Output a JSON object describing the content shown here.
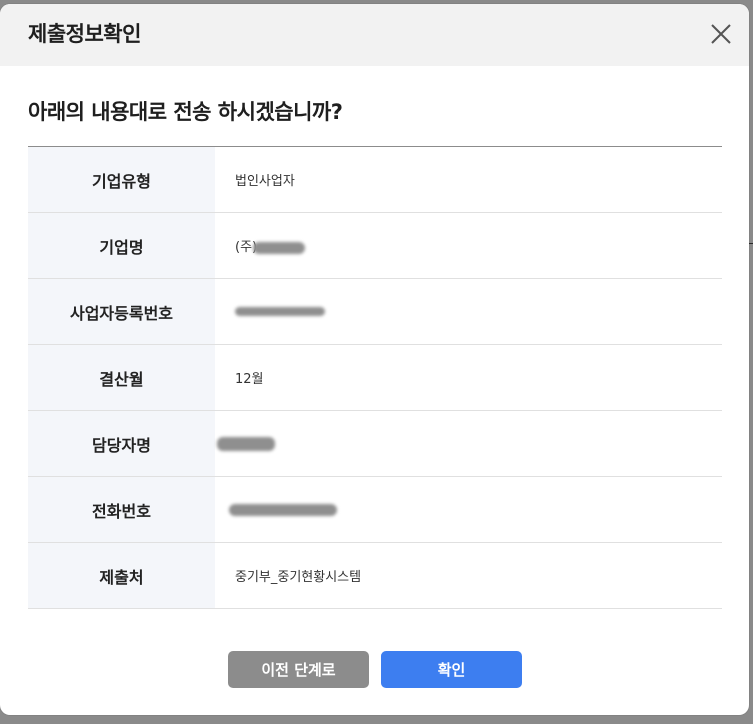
{
  "modal": {
    "title": "제출정보확인",
    "question": "아래의 내용대로 전송 하시겠습니까?",
    "close_icon": "close-icon"
  },
  "rows": [
    {
      "label": "기업유형",
      "value": "법인사업자",
      "redacted": false
    },
    {
      "label": "기업명",
      "value": "(주)",
      "redacted": true
    },
    {
      "label": "사업자등록번호",
      "value": "",
      "redacted": true
    },
    {
      "label": "결산월",
      "value": "12월",
      "redacted": false
    },
    {
      "label": "담당자명",
      "value": "",
      "redacted": true
    },
    {
      "label": "전화번호",
      "value": "",
      "redacted": true
    },
    {
      "label": "제출처",
      "value": "중기부_중기현황시스템",
      "redacted": false
    }
  ],
  "buttons": {
    "prev_label": "이전 단계로",
    "confirm_label": "확인"
  },
  "colors": {
    "header_bg": "#f2f2f2",
    "label_bg": "#f4f6fa",
    "prev_button": "#8c8c8c",
    "confirm_button": "#3d7ef0"
  }
}
